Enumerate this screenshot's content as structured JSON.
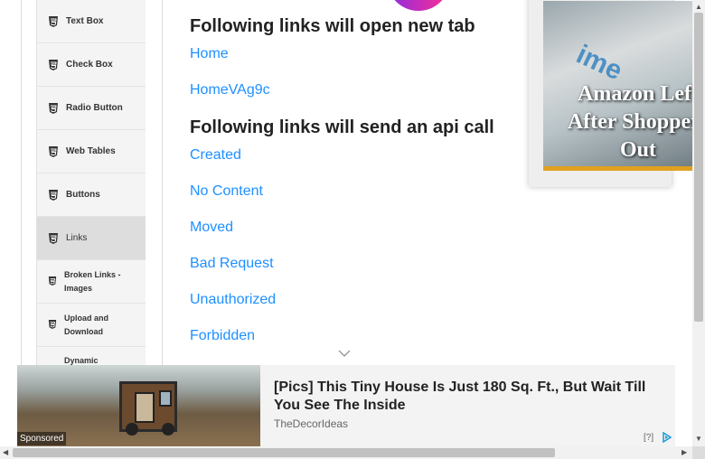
{
  "sidebar": {
    "items": [
      {
        "label": "Text Box",
        "active": false
      },
      {
        "label": "Check Box",
        "active": false
      },
      {
        "label": "Radio Button",
        "active": false
      },
      {
        "label": "Web Tables",
        "active": false
      },
      {
        "label": "Buttons",
        "active": false
      },
      {
        "label": "Links",
        "active": true
      },
      {
        "label": "Broken Links - Images",
        "active": false
      },
      {
        "label": "Upload and Download",
        "active": false
      },
      {
        "label": "Dynamic",
        "active": false
      }
    ]
  },
  "main": {
    "new_tab_heading": "Following links will open new tab",
    "new_tab_links": [
      "Home",
      "HomeVAg9c"
    ],
    "api_heading": "Following links will send an api call",
    "api_links": [
      "Created",
      "No Content",
      "Moved",
      "Bad Request",
      "Unauthorized",
      "Forbidden"
    ]
  },
  "right_ad": {
    "caption": "Amazon Left After Shoppers Out",
    "image_text": "ime"
  },
  "bottom_ad": {
    "headline": "[Pics] This Tiny House Is Just 180 Sq. Ft., But Wait Till You See The Inside",
    "source": "TheDecorIdeas",
    "sponsored": "Sponsored",
    "help": "[?]"
  },
  "colors": {
    "link": "#1e90ff",
    "active_item": "#dddddd",
    "ad_border": "#e0a120"
  }
}
